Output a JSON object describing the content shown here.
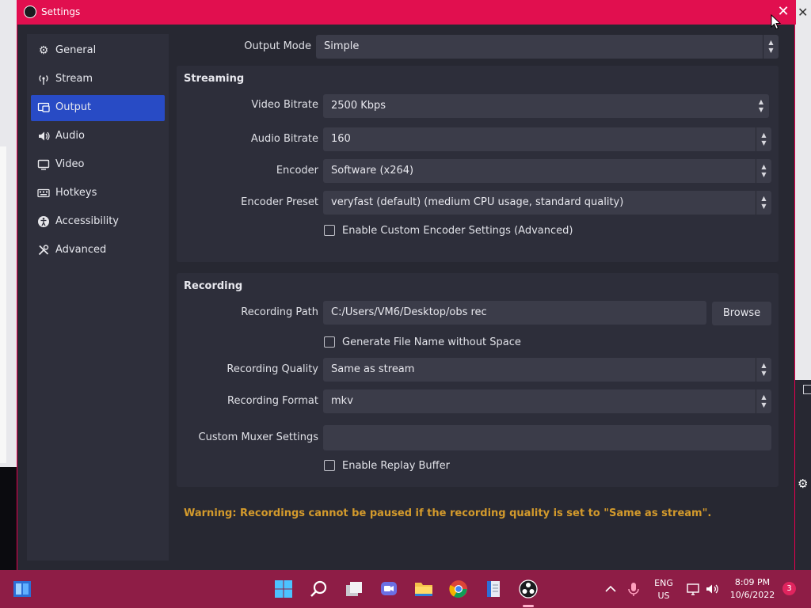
{
  "window": {
    "title": "Settings"
  },
  "sidebar": {
    "items": [
      {
        "label": "General",
        "icon": "gear-icon"
      },
      {
        "label": "Stream",
        "icon": "antenna-icon"
      },
      {
        "label": "Output",
        "icon": "output-icon",
        "active": true
      },
      {
        "label": "Audio",
        "icon": "speaker-icon"
      },
      {
        "label": "Video",
        "icon": "monitor-icon"
      },
      {
        "label": "Hotkeys",
        "icon": "keyboard-icon"
      },
      {
        "label": "Accessibility",
        "icon": "accessibility-icon"
      },
      {
        "label": "Advanced",
        "icon": "tools-icon"
      }
    ]
  },
  "output_mode": {
    "label": "Output Mode",
    "value": "Simple"
  },
  "streaming": {
    "title": "Streaming",
    "video_bitrate": {
      "label": "Video Bitrate",
      "value": "2500 Kbps"
    },
    "audio_bitrate": {
      "label": "Audio Bitrate",
      "value": "160"
    },
    "encoder": {
      "label": "Encoder",
      "value": "Software (x264)"
    },
    "encoder_preset": {
      "label": "Encoder Preset",
      "value": "veryfast (default) (medium CPU usage, standard quality)"
    },
    "custom_encoder": {
      "label": "Enable Custom Encoder Settings (Advanced)",
      "checked": false
    }
  },
  "recording": {
    "title": "Recording",
    "path": {
      "label": "Recording Path",
      "value": "C:/Users/VM6/Desktop/obs rec",
      "browse_label": "Browse"
    },
    "no_space": {
      "label": "Generate File Name without Space",
      "checked": false
    },
    "quality": {
      "label": "Recording Quality",
      "value": "Same as stream"
    },
    "format": {
      "label": "Recording Format",
      "value": "mkv"
    },
    "muxer": {
      "label": "Custom Muxer Settings",
      "value": ""
    },
    "replay_buffer": {
      "label": "Enable Replay Buffer",
      "checked": false
    }
  },
  "warning": "Warning: Recordings cannot be paused if the recording quality is set to \"Same as stream\".",
  "taskbar": {
    "lang": "ENG",
    "region": "US",
    "time": "8:09 PM",
    "date": "10/6/2022",
    "notifications": "3"
  },
  "colors": {
    "accent": "#284bc5",
    "titlebar": "#e10f4f",
    "taskbar": "#8e1d46",
    "warning": "#d39a2c"
  }
}
